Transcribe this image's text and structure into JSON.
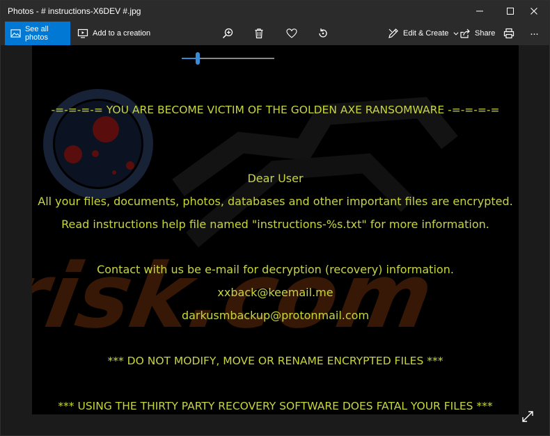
{
  "window": {
    "title": "Photos - # instructions-X6DEV #.jpg"
  },
  "toolbar": {
    "see_all_label": "See all photos",
    "add_creation_label": "Add to a creation",
    "edit_create_label": "Edit & Create",
    "share_label": "Share",
    "more_label": "···"
  },
  "zoom": {
    "level": 0.17
  },
  "ransom_note": {
    "header": "-=-=-=-= YOU ARE BECOME VICTIM OF THE GOLDEN AXE RANSOMWARE -=-=-=-=",
    "greeting": "Dear User",
    "line1": "All your files, documents, photos, databases and other important files are encrypted.",
    "line2": "Read instructions help file named \"instructions-%s.txt\" for more information.",
    "contact": "Contact with us be e-mail for decryption (recovery) information.",
    "email1": "xxback@keemail.me",
    "email2": "darkusmbackup@protonmail.com",
    "warning1": "*** DO NOT MODIFY, MOVE OR RENAME ENCRYPTED FILES ***",
    "warning2": "*** USING THE THIRTY PARTY RECOVERY SOFTWARE DOES FATAL YOUR FILES ***"
  },
  "watermark": {
    "text": "risk.com"
  },
  "colors": {
    "accent": "#0078d4",
    "note_text": "#c8d63e",
    "chrome": "#2b2b2b",
    "watermark": "#4a2008"
  }
}
